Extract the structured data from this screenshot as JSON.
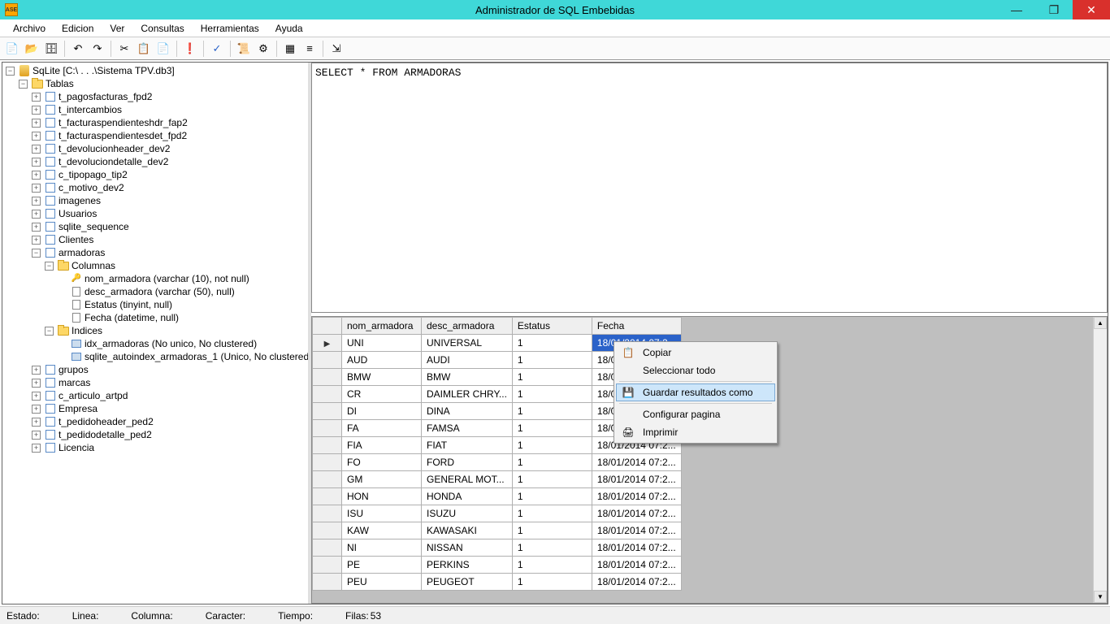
{
  "title": "Administrador de SQL Embebidas",
  "menus": [
    "Archivo",
    "Edicion",
    "Ver",
    "Consultas",
    "Herramientas",
    "Ayuda"
  ],
  "db_root": "SqLite [C:\\ . . .\\Sistema TPV.db3]",
  "tree": {
    "tablas": "Tablas",
    "tables": [
      "t_pagosfacturas_fpd2",
      "t_intercambios",
      "t_facturaspendienteshdr_fap2",
      "t_facturaspendientesdet_fpd2",
      "t_devolucionheader_dev2",
      "t_devoluciondetalle_dev2",
      "c_tipopago_tip2",
      "c_motivo_dev2",
      "imagenes",
      "Usuarios",
      "sqlite_sequence",
      "Clientes"
    ],
    "armadoras": "armadoras",
    "columnas": "Columnas",
    "cols": [
      "nom_armadora (varchar (10), not null)",
      "desc_armadora (varchar (50), null)",
      "Estatus (tinyint, null)",
      "Fecha (datetime, null)"
    ],
    "indices": "Indices",
    "idx": [
      "idx_armadoras (No unico, No clustered)",
      "sqlite_autoindex_armadoras_1 (Unico, No clustered)"
    ],
    "rest": [
      "grupos",
      "marcas",
      "c_articulo_artpd",
      "Empresa",
      "t_pedidoheader_ped2",
      "t_pedidodetalle_ped2",
      "Licencia"
    ]
  },
  "sql": "SELECT * FROM ARMADORAS",
  "grid": {
    "headers": [
      "nom_armadora",
      "desc_armadora",
      "Estatus",
      "Fecha"
    ],
    "rows": [
      [
        "UNI",
        "UNIVERSAL",
        "1",
        "18/01/2014 07:2..."
      ],
      [
        "AUD",
        "AUDI",
        "1",
        "18/0"
      ],
      [
        "BMW",
        "BMW",
        "1",
        "18/0"
      ],
      [
        "CR",
        "DAIMLER CHRY...",
        "1",
        "18/0"
      ],
      [
        "DI",
        "DINA",
        "1",
        "18/0"
      ],
      [
        "FA",
        "FAMSA",
        "1",
        "18/0"
      ],
      [
        "FIA",
        "FIAT",
        "1",
        "18/01/2014 07:2..."
      ],
      [
        "FO",
        "FORD",
        "1",
        "18/01/2014 07:2..."
      ],
      [
        "GM",
        "GENERAL MOT...",
        "1",
        "18/01/2014 07:2..."
      ],
      [
        "HON",
        "HONDA",
        "1",
        "18/01/2014 07:2..."
      ],
      [
        "ISU",
        "ISUZU",
        "1",
        "18/01/2014 07:2..."
      ],
      [
        "KAW",
        "KAWASAKI",
        "1",
        "18/01/2014 07:2..."
      ],
      [
        "NI",
        "NISSAN",
        "1",
        "18/01/2014 07:2..."
      ],
      [
        "PE",
        "PERKINS",
        "1",
        "18/01/2014 07:2..."
      ],
      [
        "PEU",
        "PEUGEOT",
        "1",
        "18/01/2014 07:2..."
      ]
    ],
    "selected_row": 0,
    "selected_col": 3
  },
  "ctx": {
    "copiar": "Copiar",
    "sel_todo": "Seleccionar todo",
    "guardar": "Guardar resultados como",
    "config": "Configurar pagina",
    "imprimir": "Imprimir"
  },
  "status": {
    "estado": "Estado:",
    "linea": "Linea:",
    "columna": "Columna:",
    "caracter": "Caracter:",
    "tiempo": "Tiempo:",
    "filas_label": "Filas:",
    "filas": "53"
  }
}
